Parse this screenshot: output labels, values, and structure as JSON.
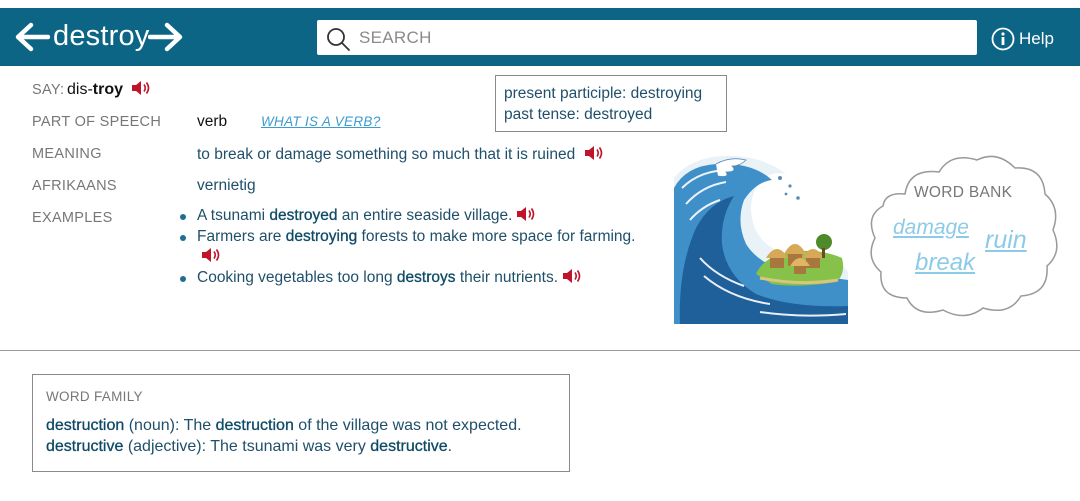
{
  "header": {
    "word": "destroy",
    "search_placeholder": "SEARCH",
    "help_label": "Help"
  },
  "say": {
    "label": "SAY:",
    "syllable1": "dis-",
    "syllable2": "troy"
  },
  "part_of_speech": {
    "label": "PART OF SPEECH",
    "value": "verb",
    "link": "WHAT IS A VERB?"
  },
  "forms": {
    "present_participle": "present participle: destroying",
    "past_tense": "past tense: destroyed"
  },
  "meaning": {
    "label": "MEANING",
    "value": "to break or damage something so much that it is ruined"
  },
  "afrikaans": {
    "label": "AFRIKAANS",
    "value": "vernietig"
  },
  "examples": {
    "label": "EXAMPLES",
    "items": [
      {
        "pre": "A tsunami ",
        "word": "destroyed",
        "post": " an entire seaside village."
      },
      {
        "pre": "Farmers are ",
        "word": "destroying",
        "post": " forests to make more space for farming."
      },
      {
        "pre": "Cooking vegetables too long ",
        "word": "destroys",
        "post": " their nutrients."
      }
    ]
  },
  "word_bank": {
    "title": "WORD BANK",
    "words": [
      "damage",
      "ruin",
      "break"
    ]
  },
  "word_family": {
    "title": "WORD FAMILY",
    "entries": [
      {
        "word": "destruction",
        "pos": " (noun): The ",
        "word2": "destruction",
        "rest": " of the village was not expected."
      },
      {
        "word": "destructive",
        "pos": " (adjective): The tsunami was very ",
        "word2": "destructive",
        "rest": "."
      }
    ]
  },
  "colors": {
    "header_bg": "#0d6585",
    "speaker": "#c0142a",
    "link": "#3c9ccf",
    "word_bank_link": "#8ccbe8"
  }
}
